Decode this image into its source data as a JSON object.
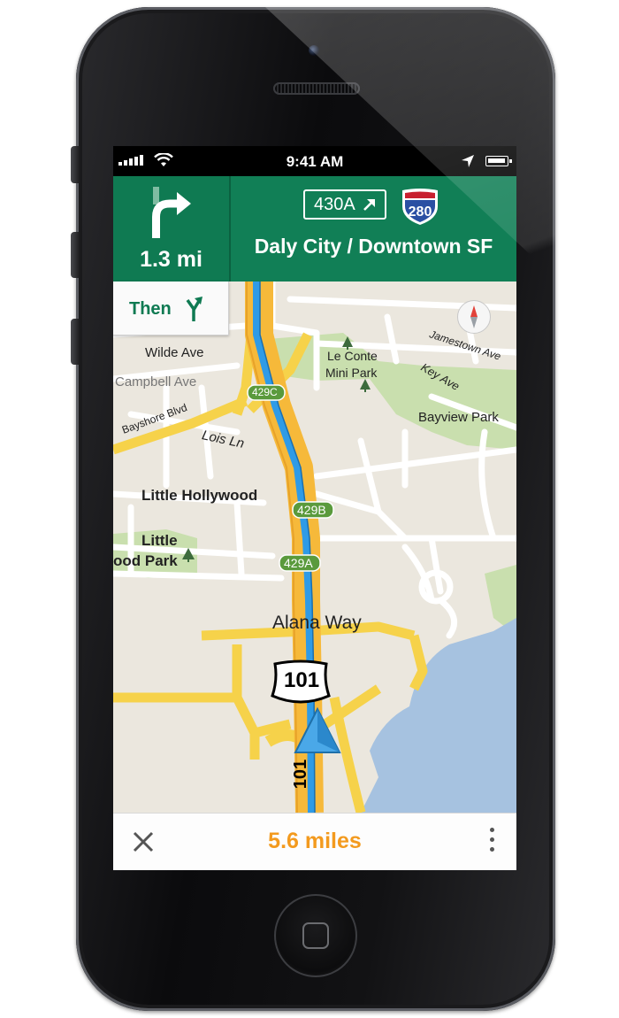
{
  "status_bar": {
    "time": "9:41 AM"
  },
  "navigation": {
    "next_turn_distance": "1.3 mi",
    "exit_number": "430A",
    "interstate_shield": "280",
    "destination": "Daly City / Downtown SF",
    "then_label": "Then"
  },
  "map": {
    "labels": {
      "wilde_ave": "Wilde Ave",
      "campbell_ave": "Campbell Ave",
      "bayshore_blvd": "Bayshore Blvd",
      "lois_ln": "Lois Ln",
      "little_hollywood": "Little Hollywood",
      "little_park_1": "Little",
      "little_park_2": "ood Park",
      "le_conte_1": "Le Conte",
      "le_conte_2": "Mini Park",
      "jamestown_ave": "Jamestown Ave",
      "key_ave": "Key Ave",
      "bayview_park": "Bayview Park",
      "alana_way": "Alana Way",
      "exit_429c": "429C",
      "exit_429b": "429B",
      "exit_429a": "429A",
      "us_101": "101",
      "road_101": "101"
    }
  },
  "bottom_bar": {
    "remaining": "5.6 miles"
  },
  "colors": {
    "header_green": "#0f7a52",
    "route_blue": "#2f9be6",
    "highway_orange": "#f6b93a",
    "miles_orange": "#f39a1e",
    "park_green": "#c9dfae",
    "water_blue": "#9fbfdf"
  },
  "icons": [
    "signal-icon",
    "wifi-icon",
    "location-icon",
    "battery-icon",
    "turn-right-icon",
    "exit-arrow-icon",
    "interstate-shield-icon",
    "fork-icon",
    "compass-icon",
    "close-icon",
    "more-icon",
    "current-location-icon",
    "park-icon"
  ]
}
